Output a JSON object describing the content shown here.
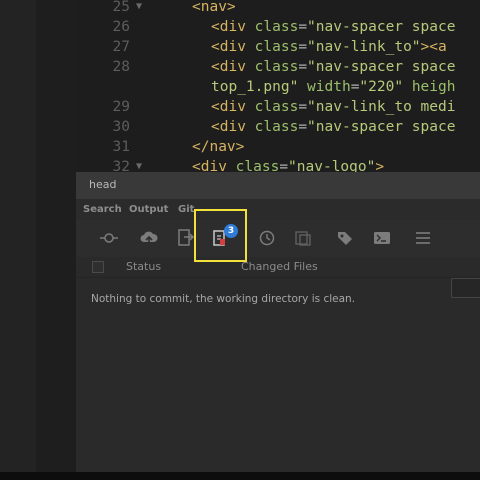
{
  "editor": {
    "lines": [
      {
        "num": "25",
        "fold": "▼",
        "indent": false,
        "parts": [
          [
            "tag",
            "<nav>"
          ]
        ]
      },
      {
        "num": "26",
        "fold": "",
        "indent": true,
        "parts": [
          [
            "tag",
            "<div "
          ],
          [
            "attr",
            "class"
          ],
          [
            "punc",
            "="
          ],
          [
            "str",
            "\"nav-spacer space"
          ]
        ]
      },
      {
        "num": "27",
        "fold": "",
        "indent": true,
        "parts": [
          [
            "tag",
            "<div "
          ],
          [
            "attr",
            "class"
          ],
          [
            "punc",
            "="
          ],
          [
            "str",
            "\"nav-link_to\""
          ],
          [
            "tag",
            "><a "
          ]
        ]
      },
      {
        "num": "28",
        "fold": "",
        "indent": true,
        "parts": [
          [
            "tag",
            "<div "
          ],
          [
            "attr",
            "class"
          ],
          [
            "punc",
            "="
          ],
          [
            "str",
            "\"nav-spacer space"
          ]
        ]
      },
      {
        "num": "",
        "fold": "",
        "indent": true,
        "parts": [
          [
            "str",
            "top_1.png\" "
          ],
          [
            "attr",
            "width"
          ],
          [
            "punc",
            "="
          ],
          [
            "str",
            "\"220\" "
          ],
          [
            "attr",
            "heigh"
          ]
        ]
      },
      {
        "num": "29",
        "fold": "",
        "indent": true,
        "parts": [
          [
            "tag",
            "<div "
          ],
          [
            "attr",
            "class"
          ],
          [
            "punc",
            "="
          ],
          [
            "str",
            "\"nav-link_to medi"
          ]
        ]
      },
      {
        "num": "30",
        "fold": "",
        "indent": true,
        "parts": [
          [
            "tag",
            "<div "
          ],
          [
            "attr",
            "class"
          ],
          [
            "punc",
            "="
          ],
          [
            "str",
            "\"nav-spacer space"
          ]
        ]
      },
      {
        "num": "31",
        "fold": "",
        "indent": false,
        "parts": [
          [
            "tag",
            "</nav>"
          ]
        ]
      },
      {
        "num": "32",
        "fold": "▼",
        "indent": false,
        "parts": [
          [
            "tag",
            "<div "
          ],
          [
            "attr",
            "class"
          ],
          [
            "punc",
            "="
          ],
          [
            "str",
            "\"nav-logo\""
          ],
          [
            "tag",
            ">"
          ]
        ]
      }
    ]
  },
  "panel": {
    "title": "head",
    "tabs": {
      "search": "Search",
      "output": "Output",
      "git": "Git"
    },
    "toolbar": {
      "commit_badge": "3",
      "icons": [
        "commit-graph-icon",
        "cloud-upload-icon",
        "pull-icon",
        "changes-icon",
        "history-icon",
        "stash-icon",
        "tag-icon",
        "terminal-icon",
        "menu-icon"
      ]
    },
    "columns": {
      "status": "Status",
      "changed_files": "Changed Files"
    },
    "message": "Nothing to commit, the working directory is clean."
  },
  "colors": {
    "highlight": "#f2e13b",
    "badge": "#2f7bd6"
  }
}
